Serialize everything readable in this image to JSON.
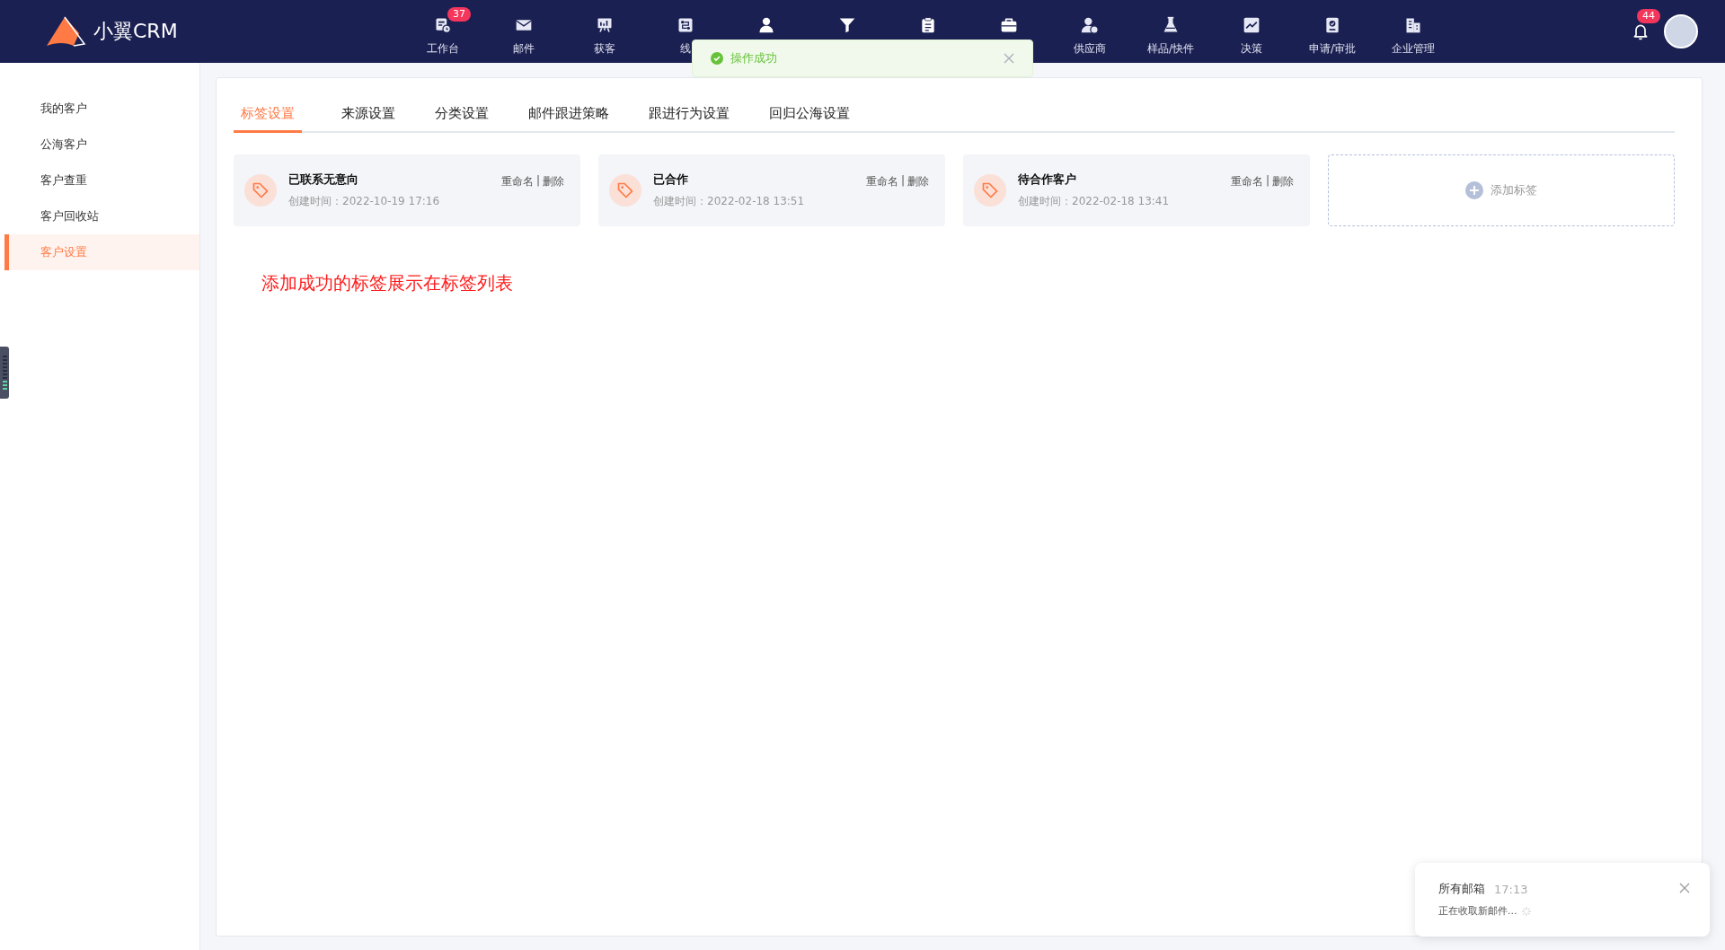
{
  "app": {
    "logo": "小翼CRM"
  },
  "nav_items": [
    {
      "kind": "labeled",
      "label": "工作台",
      "badge": "37"
    },
    {
      "kind": "labeled",
      "label": "邮件"
    },
    {
      "kind": "labeled",
      "label": "获客"
    },
    {
      "kind": "labeled",
      "label": "线"
    },
    {
      "kind": "icon"
    },
    {
      "kind": "icon"
    },
    {
      "kind": "icon"
    },
    {
      "kind": "icon"
    },
    {
      "kind": "labeled",
      "label": "供应商"
    },
    {
      "kind": "labeled",
      "label": "样品/快件"
    },
    {
      "kind": "labeled",
      "label": "决策"
    },
    {
      "kind": "labeled",
      "label": "申请/审批"
    },
    {
      "kind": "labeled",
      "label": "企业管理"
    }
  ],
  "notifications": {
    "badge": "44"
  },
  "sidebar": {
    "items": [
      {
        "label": "我的客户",
        "selected": false
      },
      {
        "label": "公海客户",
        "selected": false
      },
      {
        "label": "客户查重",
        "selected": false
      },
      {
        "label": "客户回收站",
        "selected": false
      },
      {
        "label": "客户设置",
        "selected": true
      }
    ]
  },
  "tabs": [
    {
      "label": "标签设置",
      "selected": true
    },
    {
      "label": "来源设置",
      "selected": false
    },
    {
      "label": "分类设置",
      "selected": false
    },
    {
      "label": "邮件跟进策略",
      "selected": false
    },
    {
      "label": "跟进行为设置",
      "selected": false
    },
    {
      "label": "回归公海设置",
      "selected": false
    }
  ],
  "tags": [
    {
      "name": "已联系无意向",
      "created": "创建时间：2022-10-19 17:16",
      "rename": "重命名",
      "separator": "|",
      "delete": "删除"
    },
    {
      "name": "已合作",
      "created": "创建时间：2022-02-18 13:51",
      "rename": "重命名",
      "separator": "|",
      "delete": "删除"
    },
    {
      "name": "待合作客户",
      "created": "创建时间：2022-02-18 13:41",
      "rename": "重命名",
      "separator": "|",
      "delete": "删除"
    }
  ],
  "add_tag": {
    "label": "添加标签"
  },
  "annotation": "添加成功的标签展示在标签列表",
  "toast": {
    "kind": "success",
    "message": "操作成功"
  },
  "mail_notice": {
    "title": "所有邮箱",
    "time": "17:13",
    "message": "正在收取新邮件..."
  }
}
